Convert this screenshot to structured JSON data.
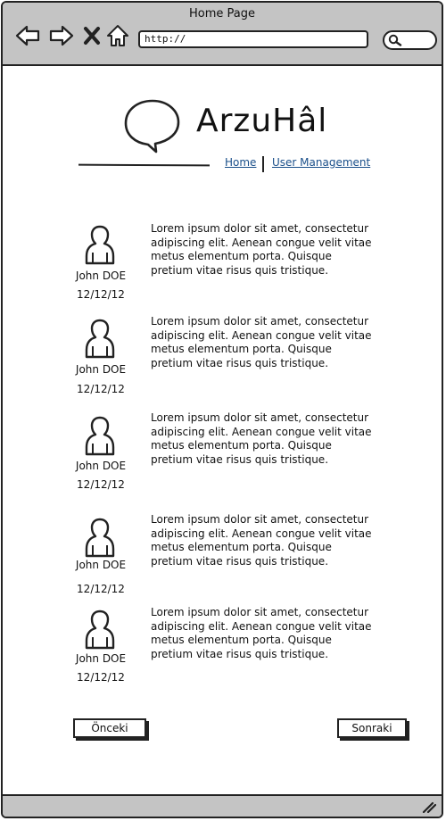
{
  "window": {
    "title": "Home Page"
  },
  "browser": {
    "address": "http://",
    "icons": [
      "back-arrow-icon",
      "forward-arrow-icon",
      "close-x-icon",
      "home-icon",
      "search-icon"
    ]
  },
  "header": {
    "app_title": "ArzuHâl",
    "logo_icon": "speech-bubble-icon",
    "nav": [
      {
        "label": "Home"
      },
      {
        "label": "User Management"
      }
    ]
  },
  "posts": [
    {
      "author": "John DOE",
      "date": "12/12/12",
      "text": "Lorem ipsum dolor sit amet, consectetur adipiscing elit. Aenean congue velit vitae metus elementum porta. Quisque pretium vitae risus quis tristique."
    },
    {
      "author": "John DOE",
      "date": "12/12/12",
      "text": "Lorem ipsum dolor sit amet, consectetur adipiscing elit. Aenean congue velit vitae metus elementum porta. Quisque pretium vitae risus quis tristique."
    },
    {
      "author": "John DOE",
      "date": "12/12/12",
      "text": "Lorem ipsum dolor sit amet, consectetur adipiscing elit. Aenean congue velit vitae metus elementum porta. Quisque pretium vitae risus quis tristique."
    },
    {
      "author": "John DOE",
      "date": "12/12/12",
      "text": "Lorem ipsum dolor sit amet, consectetur adipiscing elit. Aenean congue velit vitae metus elementum porta. Quisque pretium vitae risus quis tristique."
    },
    {
      "author": "John DOE",
      "date": "12/12/12",
      "text": "Lorem ipsum dolor sit amet, consectetur adipiscing elit. Aenean congue velit vitae metus elementum porta. Quisque pretium vitae risus quis tristique."
    }
  ],
  "pagination": {
    "prev_label": "Önceki",
    "next_label": "Sonraki"
  },
  "colors": {
    "chrome": "#c4c4c4",
    "link": "#1a4f8a",
    "ink": "#222222"
  }
}
